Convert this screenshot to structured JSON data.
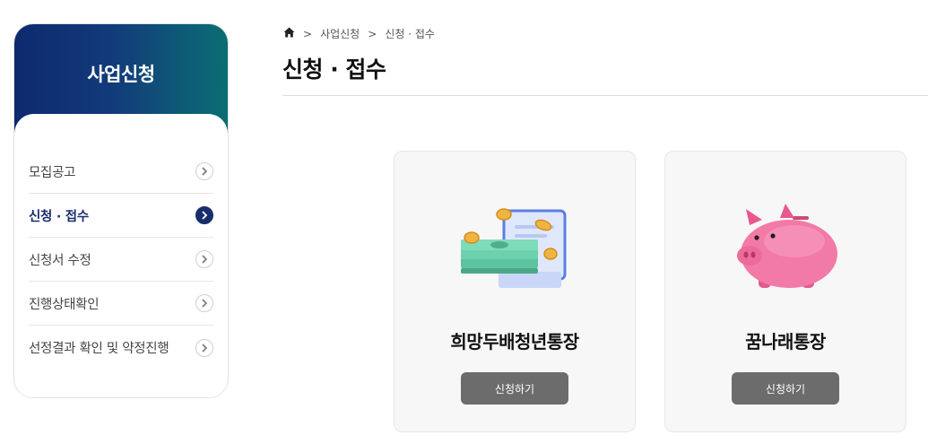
{
  "sidebar": {
    "title": "사업신청",
    "items": [
      {
        "label": "모집공고"
      },
      {
        "label": "신청 · 접수"
      },
      {
        "label": "신청서 수정"
      },
      {
        "label": "진행상태확인"
      },
      {
        "label": "선정결과 확인 및 약정진행"
      }
    ],
    "active_index": 1
  },
  "breadcrumb": {
    "home_icon": "home-icon",
    "level1": "사업신청",
    "level2": "신청 · 접수"
  },
  "page": {
    "title": "신청 · 접수"
  },
  "cards": [
    {
      "name": "희망두배청년통장",
      "button": "신청하기",
      "icon": "money-bills-coins-icon"
    },
    {
      "name": "꿈나래통장",
      "button": "신청하기",
      "icon": "piggy-bank-icon"
    }
  ],
  "colors": {
    "header_gradient_start": "#0d2a6e",
    "header_gradient_end": "#0a6e74",
    "active_text": "#1a2d6b",
    "button_bg": "#6c6c6c"
  }
}
